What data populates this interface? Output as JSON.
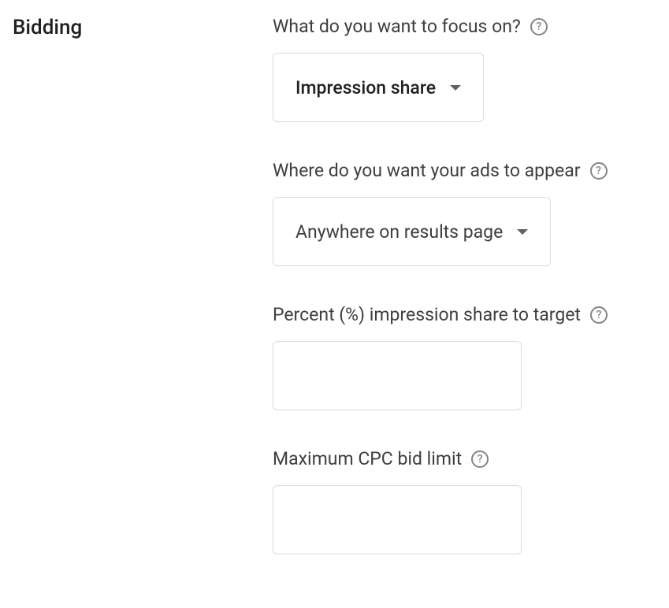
{
  "section": {
    "title": "Bidding"
  },
  "fields": {
    "focus": {
      "label": "What do you want to focus on?",
      "value": "Impression share"
    },
    "adLocation": {
      "label": "Where do you want your ads to appear",
      "value": "Anywhere on results page"
    },
    "percentTarget": {
      "label": "Percent (%) impression share to target",
      "value": ""
    },
    "maxCpc": {
      "label": "Maximum CPC bid limit",
      "value": ""
    }
  }
}
